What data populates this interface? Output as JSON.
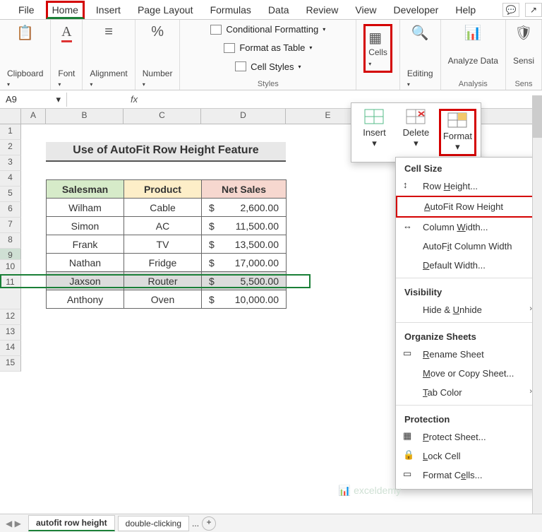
{
  "tabs": [
    "File",
    "Home",
    "Insert",
    "Page Layout",
    "Formulas",
    "Data",
    "Review",
    "View",
    "Developer",
    "Help"
  ],
  "active_tab": "Home",
  "ribbon": {
    "clipboard": "Clipboard",
    "font": "Font",
    "alignment": "Alignment",
    "number": "Number",
    "styles_caption": "Styles",
    "cond_fmt": "Conditional Formatting",
    "fmt_table": "Format as Table",
    "cell_styles": "Cell Styles",
    "cells": "Cells",
    "editing": "Editing",
    "analyze": "Analyze Data",
    "analysis_caption": "Analysis",
    "sensi": "Sensi",
    "sens_caption": "Sens"
  },
  "namebox": "A9",
  "cols": [
    "A",
    "B",
    "C",
    "D",
    "E"
  ],
  "rows": [
    "1",
    "2",
    "3",
    "4",
    "5",
    "6",
    "7",
    "8",
    "9",
    "10",
    "11",
    "12",
    "13",
    "14",
    "15"
  ],
  "title": "Use of AutoFit Row Height Feature",
  "table": {
    "headers": [
      "Salesman",
      "Product",
      "Net Sales"
    ],
    "rows": [
      {
        "s": "Wilham",
        "p": "Cable",
        "c": "$",
        "n": "2,600.00"
      },
      {
        "s": "Simon",
        "p": "AC",
        "c": "$",
        "n": "11,500.00"
      },
      {
        "s": "Frank",
        "p": "TV",
        "c": "$",
        "n": "13,500.00"
      },
      {
        "s": "Nathan",
        "p": "Fridge",
        "c": "$",
        "n": "17,000.00"
      },
      {
        "s": "Jaxson",
        "p": "Router",
        "c": "$",
        "n": "5,500.00"
      },
      {
        "s": "Anthony",
        "p": "Oven",
        "c": "$",
        "n": "10,000.00"
      }
    ],
    "selected_index": 4
  },
  "cells_popup": {
    "insert": "Insert",
    "delete": "Delete",
    "format": "Format"
  },
  "format_menu": {
    "sec_cellsize": "Cell Size",
    "row_height": "Row Height...",
    "autofit_row": "AutoFit Row Height",
    "col_width": "Column Width...",
    "autofit_col": "AutoFit Column Width",
    "default_width": "Default Width...",
    "sec_visibility": "Visibility",
    "hide_unhide": "Hide & Unhide",
    "sec_org": "Organize Sheets",
    "rename": "Rename Sheet",
    "movecopy": "Move or Copy Sheet...",
    "tabcolor": "Tab Color",
    "sec_prot": "Protection",
    "protect": "Protect Sheet...",
    "lock": "Lock Cell",
    "fmtcells": "Format Cells..."
  },
  "sheets": {
    "active": "autofit row height",
    "other": "double-clicking",
    "more": "..."
  },
  "watermark": "exceldemy"
}
